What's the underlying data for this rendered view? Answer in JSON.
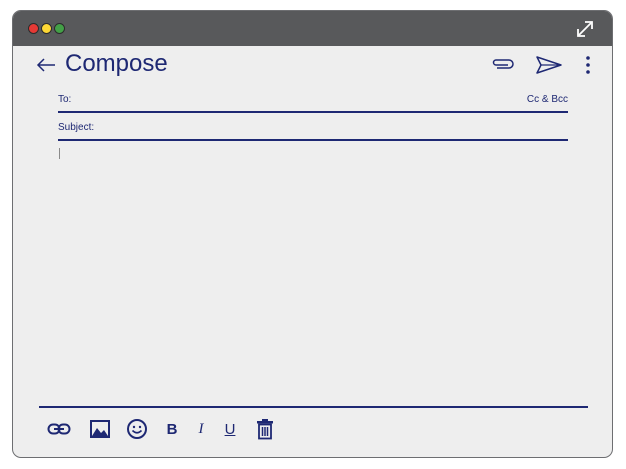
{
  "compose": {
    "title": "Compose",
    "to_label": "To:",
    "cc_bcc_label": "Cc & Bcc",
    "subject_label": "Subject:"
  },
  "toolbar": {
    "bold_label": "B",
    "italic_label": "I",
    "underline_label": "U"
  },
  "colors": {
    "accent": "#1e2873",
    "titlebar": "#58595b",
    "background": "#eeeeee"
  },
  "icons": [
    "back-arrow-icon",
    "attachment-icon",
    "send-icon",
    "more-vert-icon",
    "link-icon",
    "image-icon",
    "emoji-icon",
    "trash-icon",
    "expand-icon"
  ]
}
